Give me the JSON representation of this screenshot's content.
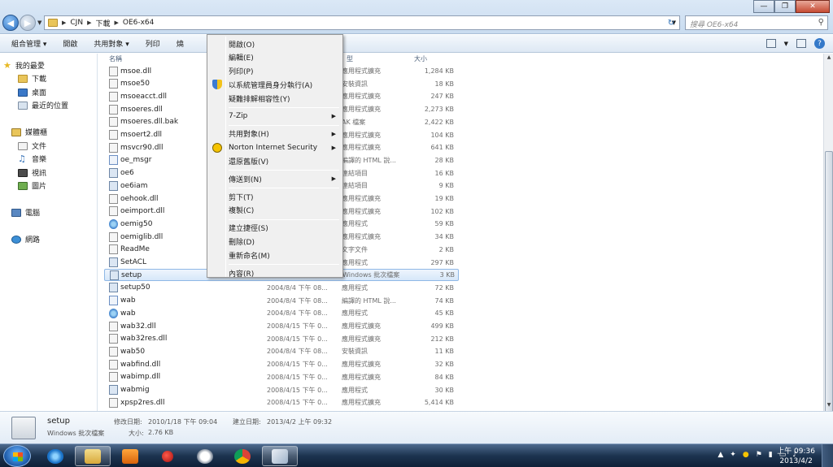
{
  "address": {
    "crumbs": [
      "CJN",
      "下載",
      "OE6-x64"
    ],
    "search_placeholder": "搜尋 OE6-x64"
  },
  "toolbar": {
    "organize": "組合管理 ▾",
    "open": "開啟",
    "share": "共用對象 ▾",
    "print": "列印",
    "more": "燒"
  },
  "sidebar": {
    "favorites": "我的最愛",
    "fav_items": [
      "下載",
      "桌面",
      "最近的位置"
    ],
    "libraries": "媒體櫃",
    "lib_items": [
      "文件",
      "音樂",
      "視訊",
      "圖片"
    ],
    "computer": "電腦",
    "network": "網路"
  },
  "columns": {
    "name": "名稱",
    "type": "型",
    "size": "大小"
  },
  "files": [
    {
      "name": "msoe.dll",
      "date": "",
      "type": "應用程式擴充",
      "size": "1,284 KB",
      "icon": "dll"
    },
    {
      "name": "msoe50",
      "date": "",
      "type": "安裝資訊",
      "size": "18 KB",
      "icon": "dll"
    },
    {
      "name": "msoeacct.dll",
      "date": "",
      "type": "應用程式擴充",
      "size": "247 KB",
      "icon": "dll"
    },
    {
      "name": "msoeres.dll",
      "date": "",
      "type": "應用程式擴充",
      "size": "2,273 KB",
      "icon": "dll"
    },
    {
      "name": "msoeres.dll.bak",
      "date": "",
      "type": "AK 檔案",
      "size": "2,422 KB",
      "icon": "file"
    },
    {
      "name": "msoert2.dll",
      "date": "",
      "type": "應用程式擴充",
      "size": "104 KB",
      "icon": "dll"
    },
    {
      "name": "msvcr90.dll",
      "date": "",
      "type": "應用程式擴充",
      "size": "641 KB",
      "icon": "dll"
    },
    {
      "name": "oe_msgr",
      "date": "",
      "type": "編譯的 HTML 說...",
      "size": "28 KB",
      "icon": "html"
    },
    {
      "name": "oe6",
      "date": "",
      "type": "連結項目",
      "size": "16 KB",
      "icon": "exe"
    },
    {
      "name": "oe6iam",
      "date": "",
      "type": "連結項目",
      "size": "9 KB",
      "icon": "exe"
    },
    {
      "name": "oehook.dll",
      "date": "",
      "type": "應用程式擴充",
      "size": "19 KB",
      "icon": "dll"
    },
    {
      "name": "oeimport.dll",
      "date": "",
      "type": "應用程式擴充",
      "size": "102 KB",
      "icon": "dll"
    },
    {
      "name": "oemig50",
      "date": "",
      "type": "應用程式",
      "size": "59 KB",
      "icon": "ico"
    },
    {
      "name": "oemiglib.dll",
      "date": "",
      "type": "應用程式擴充",
      "size": "34 KB",
      "icon": "dll"
    },
    {
      "name": "ReadMe",
      "date": "",
      "type": "文字文件",
      "size": "2 KB",
      "icon": "file"
    },
    {
      "name": "SetACL",
      "date": "",
      "type": "應用程式",
      "size": "297 KB",
      "icon": "exe"
    },
    {
      "name": "setup",
      "date": "2010/1/18 下午 09...",
      "type": "Windows 批次檔案",
      "size": "3 KB",
      "icon": "exe"
    },
    {
      "name": "setup50",
      "date": "2004/8/4 下午 08...",
      "type": "應用程式",
      "size": "72 KB",
      "icon": "exe"
    },
    {
      "name": "wab",
      "date": "2004/8/4 下午 08...",
      "type": "編譯的 HTML 說...",
      "size": "74 KB",
      "icon": "html"
    },
    {
      "name": "wab",
      "date": "2004/8/4 下午 08...",
      "type": "應用程式",
      "size": "45 KB",
      "icon": "ico"
    },
    {
      "name": "wab32.dll",
      "date": "2008/4/15 下午 0...",
      "type": "應用程式擴充",
      "size": "499 KB",
      "icon": "dll"
    },
    {
      "name": "wab32res.dll",
      "date": "2008/4/15 下午 0...",
      "type": "應用程式擴充",
      "size": "212 KB",
      "icon": "dll"
    },
    {
      "name": "wab50",
      "date": "2004/8/4 下午 08...",
      "type": "安裝資訊",
      "size": "11 KB",
      "icon": "dll"
    },
    {
      "name": "wabfind.dll",
      "date": "2008/4/15 下午 0...",
      "type": "應用程式擴充",
      "size": "32 KB",
      "icon": "dll"
    },
    {
      "name": "wabimp.dll",
      "date": "2008/4/15 下午 0...",
      "type": "應用程式擴充",
      "size": "84 KB",
      "icon": "dll"
    },
    {
      "name": "wabmig",
      "date": "2008/4/15 下午 0...",
      "type": "應用程式",
      "size": "30 KB",
      "icon": "exe"
    },
    {
      "name": "xpsp2res.dll",
      "date": "2008/4/15 下午 0...",
      "type": "應用程式擴充",
      "size": "5,414 KB",
      "icon": "dll"
    }
  ],
  "selected_index": 16,
  "context_menu": [
    {
      "label": "開啟(O)"
    },
    {
      "label": "編輯(E)"
    },
    {
      "label": "列印(P)"
    },
    {
      "label": "以系統管理員身分執行(A)",
      "icon": "shield"
    },
    {
      "label": "疑難排解相容性(Y)"
    },
    {
      "label": "7-Zip",
      "submenu": true
    },
    {
      "label": "共用對象(H)",
      "submenu": true
    },
    {
      "label": "Norton Internet Security",
      "submenu": true,
      "icon": "norton"
    },
    {
      "label": "還原舊版(V)"
    },
    {
      "label": "傳送到(N)",
      "submenu": true
    },
    {
      "label": "剪下(T)"
    },
    {
      "label": "複製(C)"
    },
    {
      "label": "建立捷徑(S)"
    },
    {
      "label": "刪除(D)"
    },
    {
      "label": "重新命名(M)"
    },
    {
      "label": "內容(R)"
    }
  ],
  "details": {
    "name": "setup",
    "type": "Windows 批次檔案",
    "modified_label": "修改日期:",
    "modified": "2010/1/18 下午 09:04",
    "created_label": "建立日期:",
    "created": "2013/4/2 上午 09:32",
    "size_label": "大小:",
    "size": "2.76 KB"
  },
  "taskbar": {
    "time": "上午 09:36",
    "date": "2013/4/2"
  }
}
